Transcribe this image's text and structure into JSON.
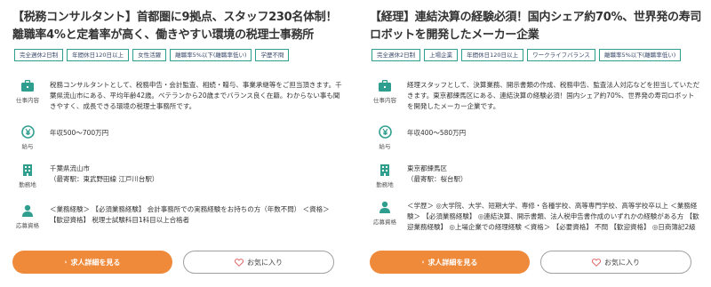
{
  "jobs": [
    {
      "title": "【税務コンサルタント】首都圏に9拠点、スタッフ230名体制！離職率4%と定着率が高く、働きやすい環境の税理士事務所",
      "tags": [
        "完全週休2日制",
        "年間休日120日以上",
        "女性活躍",
        "離職率5%以下(離職率低い)",
        "学歴不問"
      ],
      "work_label": "仕事内容",
      "work": "税務コンサルタントとして、税務申告・会計監査、相続・贈与、事業承継等をご担当頂きます。千葉県流山市にある、平均年齢42歳。ベテランから20歳までバランス良く在籍。わからない事も聞きやすく、成長できる環境の税理士事務所です。",
      "salary_label": "給与",
      "salary": "年収500〜700万円",
      "location_label": "勤務地",
      "location_line1": "千葉県流山市",
      "location_line2": "（最寄駅：東武野田線 江戸川台駅）",
      "req_label": "応募資格",
      "requirements": "＜業務経験＞ 【必須業務経験】 会計事務所での実務経験をお持ちの方（年数不問） ＜資格＞ 【歓迎資格】 税理士試験科目1科目以上合格者",
      "detail_button": "求人詳細を見る",
      "fav_button": "お気に入り"
    },
    {
      "title": "【経理】連結決算の経験必須！国内シェア約70%、世界発の寿司ロボットを開発したメーカー企業",
      "tags": [
        "完全週休2日制",
        "上場企業",
        "年間休日120日以上",
        "ワークライフバランス",
        "離職率5%以下(離職率低い)"
      ],
      "work_label": "仕事内容",
      "work": "経理スタッフとして、決算業務、開示書類の作成、税務申告、監査法人対応などを担当していただきます。東京都練馬区にある、連結決算の経験必須！国内シェア約70%、世界発の寿司ロボットを開発したメーカー企業です。",
      "salary_label": "給与",
      "salary": "年収400〜580万円",
      "location_label": "勤務地",
      "location_line1": "東京都練馬区",
      "location_line2": "（最寄駅：桜台駅）",
      "req_label": "応募資格",
      "requirements": "＜学歴＞ ◎大学院、大学、短期大学、専修・各種学校、高等専門学校、高等学校卒以上 ＜業務経験＞ 【必須業務経験】 ◎連結決算、開示書類、法人税申告書作成のいずれかの経験がある方 【歓迎業務経験】 ◎上場企業での経理経験 ＜資格＞ 【必要資格】 不問 【歓迎資格】 ◎日商簿記2級",
      "detail_button": "求人詳細を見る",
      "fav_button": "お気に入り"
    }
  ],
  "colors": {
    "accent": "#ef8a3b",
    "icon": "#2f9e8f",
    "tag_border": "#2f9e8f"
  },
  "icons": {
    "work": "briefcase-icon",
    "salary": "yen-coin-icon",
    "location": "building-icon",
    "requirements": "person-icon",
    "favorite": "heart-icon",
    "chevron": "chevron-right-icon"
  }
}
